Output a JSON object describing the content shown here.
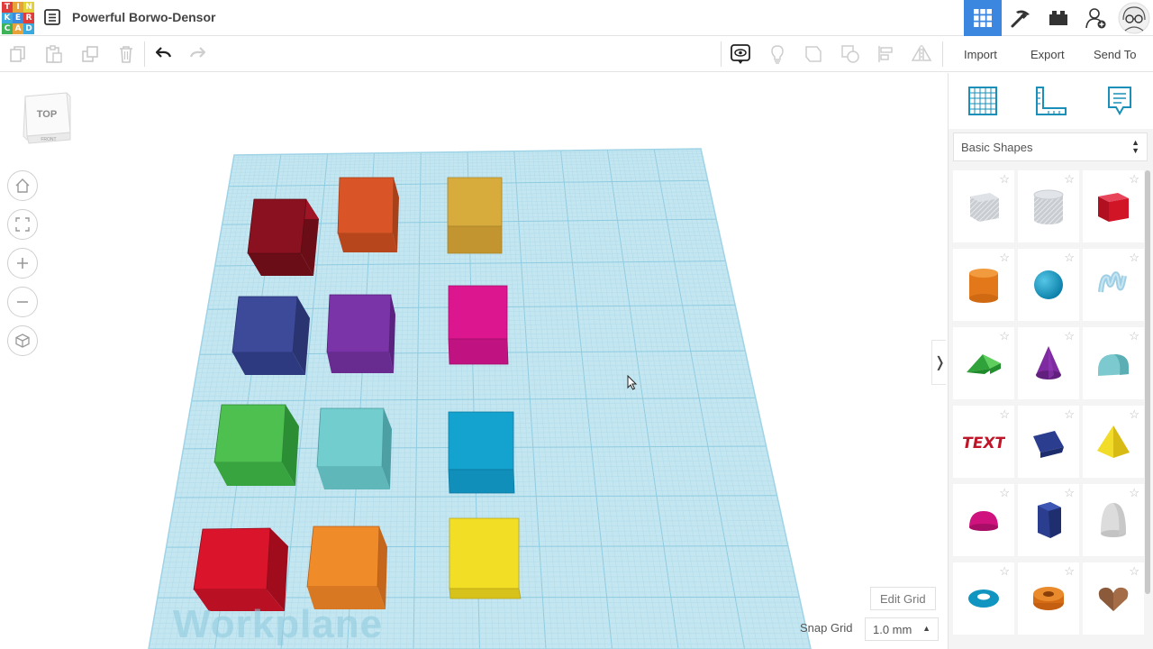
{
  "app": {
    "logo_letters": [
      "T",
      "I",
      "N",
      "K",
      "E",
      "R",
      "C",
      "A",
      "D"
    ],
    "logo_colors": [
      "#e13c3c",
      "#e8a23a",
      "#e2d23a",
      "#3aa9dd",
      "#3a8bdd",
      "#e13c3c",
      "#3fb35a",
      "#e8a23a",
      "#3aa9dd"
    ],
    "design_title": "Powerful Borwo-Densor"
  },
  "header_buttons": [
    {
      "name": "3d-view-grid-icon",
      "active": true
    },
    {
      "name": "codeblocks-pickaxe-icon",
      "active": false
    },
    {
      "name": "bricks-icon",
      "active": false
    },
    {
      "name": "add-user-icon",
      "active": false
    },
    {
      "name": "user-avatar-icon",
      "active": false
    }
  ],
  "toolbar": {
    "import_label": "Import",
    "export_label": "Export",
    "send_to_label": "Send To"
  },
  "viewcube": {
    "top_label": "TOP",
    "front_label": "FRONT"
  },
  "viewport": {
    "workplane_label": "Workplane",
    "edit_grid_label": "Edit Grid",
    "snap_grid_label": "Snap Grid",
    "snap_grid_value": "1.0 mm"
  },
  "panel": {
    "shape_category": "Basic Shapes",
    "shapes": [
      {
        "name": "box-hole"
      },
      {
        "name": "cylinder-hole"
      },
      {
        "name": "box"
      },
      {
        "name": "cylinder"
      },
      {
        "name": "sphere"
      },
      {
        "name": "scribble"
      },
      {
        "name": "roof"
      },
      {
        "name": "cone"
      },
      {
        "name": "round-roof"
      },
      {
        "name": "text"
      },
      {
        "name": "wedge"
      },
      {
        "name": "pyramid"
      },
      {
        "name": "half-sphere"
      },
      {
        "name": "polygon"
      },
      {
        "name": "paraboloid"
      },
      {
        "name": "torus"
      },
      {
        "name": "tube"
      },
      {
        "name": "heart"
      }
    ]
  },
  "colors": {
    "accent": "#3b87e0",
    "workplane": "#c3e6f1",
    "grid_line": "#8fcbe0"
  }
}
